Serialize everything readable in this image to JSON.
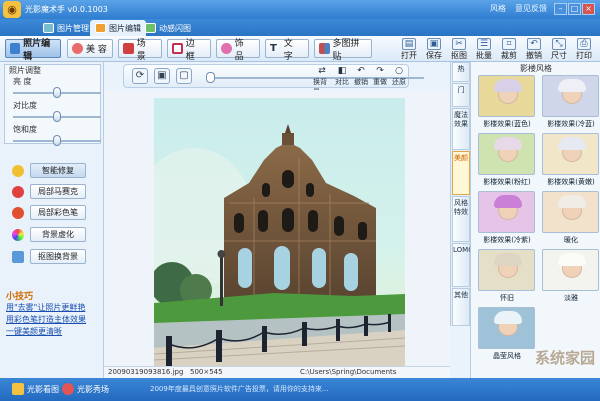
{
  "window": {
    "title": "光影魔术手 v0.0.1003",
    "menu": [
      "风格",
      "意见反馈"
    ]
  },
  "tabs": [
    {
      "label": "图片管理"
    },
    {
      "label": "图片编辑"
    },
    {
      "label": "动感闪图"
    }
  ],
  "categories": [
    "照片编辑",
    "美 容",
    "场 景",
    "边 框",
    "饰 品",
    "文 字",
    "多图拼贴"
  ],
  "actions": [
    "打开",
    "保存",
    "抠图",
    "批量",
    "裁剪",
    "撤销",
    "尺寸",
    "打印"
  ],
  "adjust": {
    "title": "照片调整",
    "sliders": [
      {
        "label": "亮 度",
        "value": 0.5
      },
      {
        "label": "对比度",
        "value": 0.5
      },
      {
        "label": "饱和度",
        "value": 0.5
      }
    ]
  },
  "features": [
    "智能修复",
    "局部马赛克",
    "局部彩色笔",
    "背景虚化",
    "抠图换背景"
  ],
  "tips": {
    "title": "小技巧",
    "items": [
      "用\"去雾\"让照片更鲜艳",
      "用彩色笔打造主体效果",
      "一键美颜更清晰"
    ]
  },
  "canvas_tools": [
    {
      "label": "换背景"
    },
    {
      "label": "对比"
    },
    {
      "label": "撤销"
    },
    {
      "label": "重做"
    },
    {
      "label": "还原"
    }
  ],
  "status": {
    "filename": "20090319093816.jpg",
    "dimensions": "500×545",
    "path": "C:\\Users\\Spring\\Documents"
  },
  "side_tabs": [
    "热",
    "门",
    "魔法效果",
    "美颜",
    "风格特效",
    "LOMO",
    "其他"
  ],
  "effects": {
    "title": "影楼风格",
    "items": [
      {
        "label": "影楼效果(蓝色)",
        "bg": "#e8d89a",
        "cap": "#d7d0e8"
      },
      {
        "label": "影楼效果(冷蓝)",
        "bg": "#d0d6ea",
        "cap": "#eef0f6"
      },
      {
        "label": "影楼效果(粉红)",
        "bg": "#cfe3b0",
        "cap": "#e8d9e8"
      },
      {
        "label": "影楼效果(黄嫩)",
        "bg": "#f2e6c8",
        "cap": "#e6e8f2"
      },
      {
        "label": "影楼效果(冷紫)",
        "bg": "#e5c4e8",
        "cap": "#c97fd6"
      },
      {
        "label": "暖化",
        "bg": "#f2e2cc",
        "cap": "#f0ece6"
      },
      {
        "label": "怀旧",
        "bg": "#e6dfc8",
        "cap": "#ddd5c2"
      },
      {
        "label": "淡雅",
        "bg": "#f4f4ee",
        "cap": "#fbfbf8"
      },
      {
        "label": "晶莹风格",
        "bg": "#9fc2d8",
        "cap": "#eaf3f8"
      }
    ]
  },
  "bottom": {
    "links": [
      "光影看图",
      "光影秀场"
    ],
    "ticker": "2009年度最具创意照片软件广告投票，请用你的支持来..."
  },
  "watermark": "系统家园",
  "colors": {
    "accent": "#2f7dd0",
    "tab_highlight": "#d06000"
  }
}
